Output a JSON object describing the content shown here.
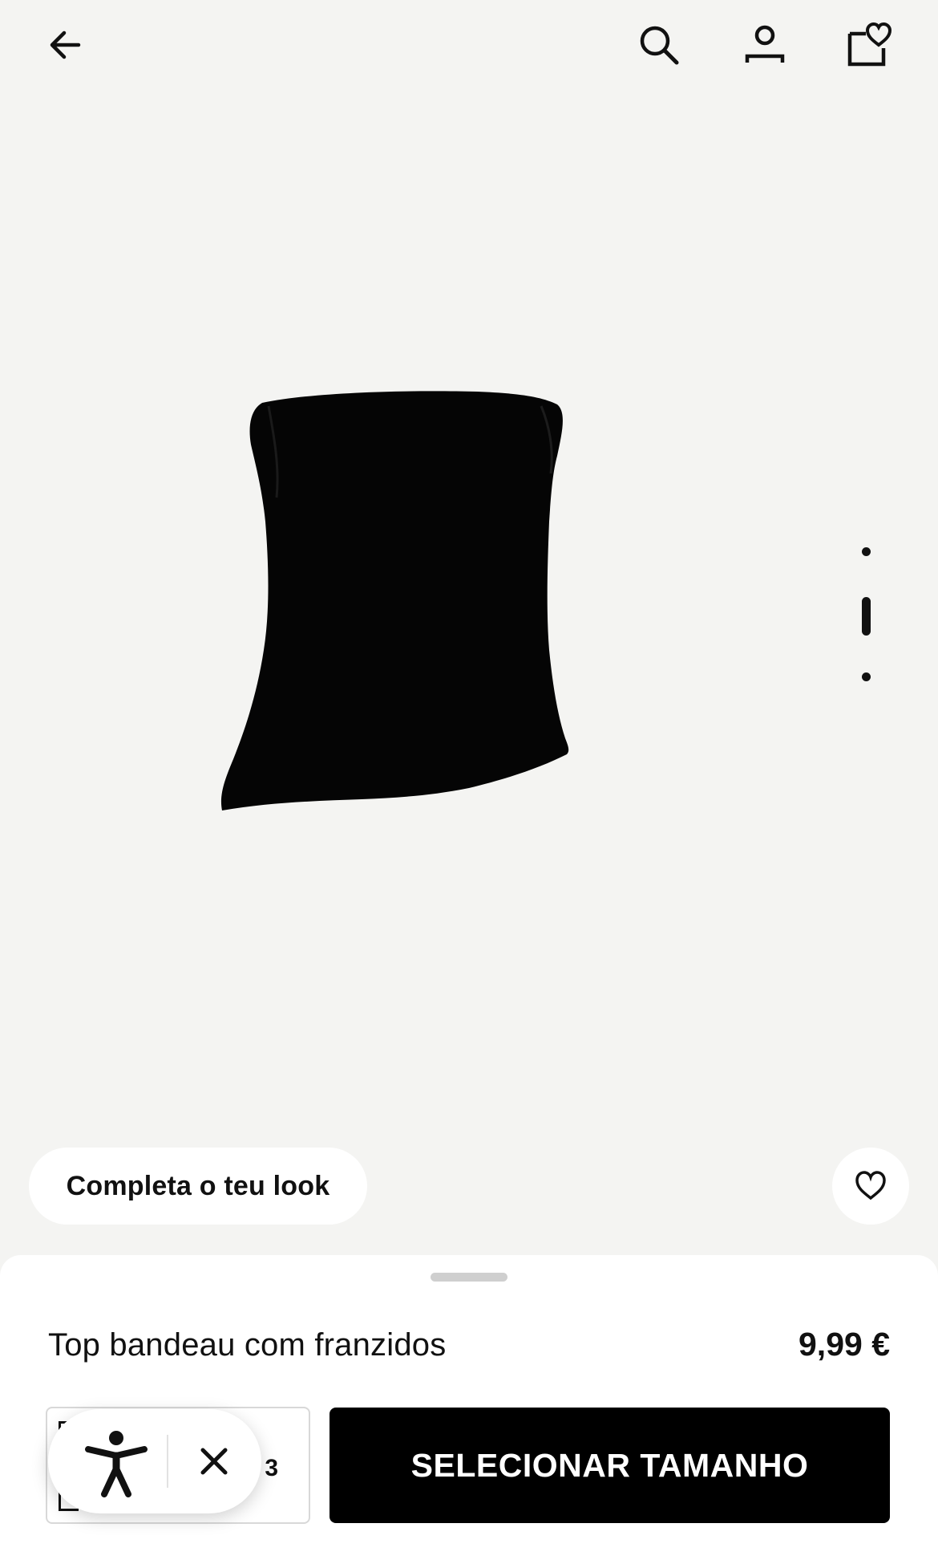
{
  "header": {
    "back_icon": "arrow-left-icon",
    "search_icon": "search-icon",
    "account_icon": "user-icon",
    "bag_icon": "bag-heart-icon"
  },
  "product": {
    "name": "Top bandeau com franzidos",
    "price": "9,99 €",
    "image_color": "#000000"
  },
  "carousel": {
    "total": 3,
    "active": 2
  },
  "actions": {
    "complete_look": "Completa o teu look",
    "select_size": "SELECIONAR TAMANHO",
    "favorite_icon": "heart-icon"
  },
  "side_box": {
    "visible_text": "3"
  },
  "accessibility_widget": {
    "icon": "accessibility-person-icon",
    "close_icon": "close-icon"
  },
  "colors": {
    "background": "#f4f4f2",
    "sheet": "#ffffff",
    "button": "#000000",
    "button_text": "#ffffff"
  }
}
